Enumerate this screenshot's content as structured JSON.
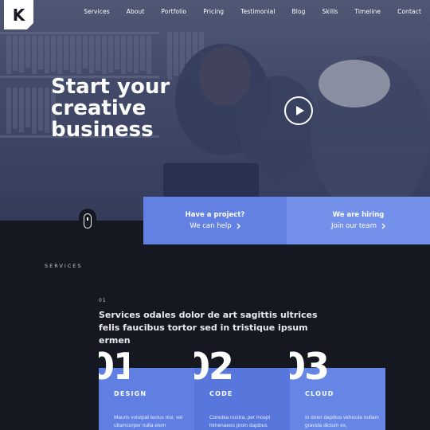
{
  "brand": {
    "logo_letter": "K"
  },
  "nav": [
    "Services",
    "About",
    "Portfolio",
    "Pricing",
    "Testimonial",
    "Blog",
    "Skills",
    "Timeline",
    "Contact"
  ],
  "hero": {
    "headline": [
      "Start your",
      "creative",
      "business"
    ]
  },
  "cta": [
    {
      "title": "Have a project?",
      "link": "We can help"
    },
    {
      "title": "We are hiring",
      "link": "Join our team"
    }
  ],
  "services": {
    "label": "SERVICES",
    "number": "01",
    "heading": "Services odales dolor de art sagittis ultrices felis faucibus tortor sed in tristique ipsum ermen",
    "cards": [
      {
        "num": "01",
        "title": "DESIGN",
        "desc": "Mauris volutpat lectus nisi, vel ullamcorper nulla elem"
      },
      {
        "num": "02",
        "title": "CODE",
        "desc": "Conubia nostra, per incept himenaeos proin dapibus"
      },
      {
        "num": "03",
        "title": "CLOUD",
        "desc": "In dolor dapibus vehicula nullam gravida dictum ex,"
      }
    ]
  },
  "icons": {
    "play": "play-icon",
    "chevron": "chevron-right-icon",
    "scroll": "mouse-scroll-icon"
  },
  "colors": {
    "dark_bg": "#151821",
    "accent": "#6381e3"
  }
}
